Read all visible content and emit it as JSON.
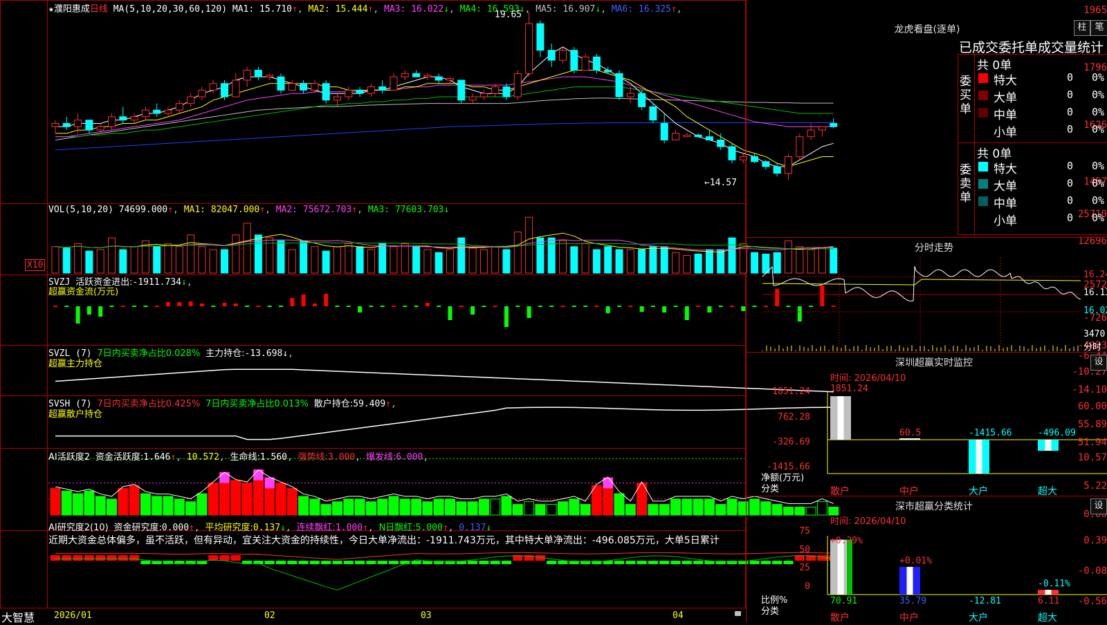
{
  "stock": {
    "star": "★",
    "name": "濮阳惠成",
    "period": "日线"
  },
  "kline": {
    "ma_def": "MA(5,10,20,30,60,120)",
    "ma": [
      {
        "label": "MA1:",
        "value": "15.710",
        "arrow": "↑",
        "color": "#ffffff"
      },
      {
        "label": "MA2:",
        "value": "15.444",
        "arrow": "↑",
        "color": "#ffff00"
      },
      {
        "label": "MA3:",
        "value": "16.022",
        "arrow": "↓",
        "color": "#ff40ff"
      },
      {
        "label": "MA4:",
        "value": "16.593",
        "arrow": "↓",
        "color": "#00ff00"
      },
      {
        "label": "MA5:",
        "value": "16.907",
        "arrow": "↓",
        "color": "#c0c0c0"
      },
      {
        "label": "MA6:",
        "value": "16.325",
        "arrow": "↑",
        "color": "#4060ff"
      }
    ],
    "y_ticks": [
      "1965",
      "1796",
      "1626",
      "1457"
    ],
    "high_label": "19.65",
    "low_label": "←14.57",
    "candles": [
      [
        16.2,
        16.4,
        16.0,
        16.3
      ],
      [
        16.3,
        16.5,
        16.1,
        16.2
      ],
      [
        16.2,
        16.6,
        16.0,
        16.4
      ],
      [
        16.4,
        16.4,
        16.0,
        16.1
      ],
      [
        16.1,
        16.3,
        16.0,
        16.2
      ],
      [
        16.2,
        16.6,
        16.1,
        16.5
      ],
      [
        16.5,
        16.8,
        16.3,
        16.4
      ],
      [
        16.4,
        16.6,
        16.3,
        16.5
      ],
      [
        16.5,
        16.8,
        16.4,
        16.7
      ],
      [
        16.7,
        16.9,
        16.5,
        16.6
      ],
      [
        16.6,
        16.8,
        16.5,
        16.7
      ],
      [
        16.7,
        17.0,
        16.6,
        16.9
      ],
      [
        16.9,
        17.2,
        16.8,
        17.1
      ],
      [
        17.1,
        17.4,
        17.0,
        17.3
      ],
      [
        17.3,
        17.6,
        17.2,
        17.5
      ],
      [
        17.5,
        17.6,
        17.0,
        17.1
      ],
      [
        17.1,
        17.8,
        17.1,
        17.6
      ],
      [
        17.6,
        18.0,
        17.4,
        17.9
      ],
      [
        17.9,
        18.0,
        17.6,
        17.7
      ],
      [
        17.7,
        17.8,
        17.6,
        17.75
      ],
      [
        17.7,
        17.8,
        17.2,
        17.3
      ],
      [
        17.3,
        17.6,
        17.3,
        17.5
      ],
      [
        17.5,
        17.6,
        17.2,
        17.3
      ],
      [
        17.3,
        17.6,
        17.2,
        17.5
      ],
      [
        17.5,
        17.6,
        16.9,
        17.0
      ],
      [
        17.0,
        17.2,
        16.8,
        17.1
      ],
      [
        17.1,
        17.4,
        17.0,
        17.3
      ],
      [
        17.3,
        17.4,
        17.1,
        17.2
      ],
      [
        17.2,
        17.5,
        17.1,
        17.4
      ],
      [
        17.4,
        17.6,
        17.2,
        17.3
      ],
      [
        17.3,
        17.8,
        17.3,
        17.7
      ],
      [
        17.7,
        17.9,
        17.6,
        17.8
      ],
      [
        17.8,
        17.9,
        17.7,
        17.7
      ],
      [
        17.7,
        17.8,
        17.6,
        17.75
      ],
      [
        17.7,
        17.8,
        17.5,
        17.6
      ],
      [
        17.6,
        17.7,
        17.5,
        17.65
      ],
      [
        17.6,
        17.6,
        16.9,
        17.0
      ],
      [
        17.0,
        17.2,
        16.9,
        17.1
      ],
      [
        17.1,
        17.3,
        17.0,
        17.2
      ],
      [
        17.2,
        17.5,
        17.1,
        17.4
      ],
      [
        17.4,
        17.5,
        17.0,
        17.1
      ],
      [
        17.1,
        17.9,
        17.0,
        17.8
      ],
      [
        17.8,
        19.65,
        17.7,
        19.3
      ],
      [
        19.3,
        19.4,
        18.3,
        18.5
      ],
      [
        18.5,
        18.7,
        18.0,
        18.2
      ],
      [
        18.2,
        18.6,
        18.1,
        18.5
      ],
      [
        18.5,
        18.6,
        17.8,
        17.9
      ],
      [
        17.9,
        18.4,
        17.9,
        18.3
      ],
      [
        18.3,
        18.4,
        17.8,
        17.9
      ],
      [
        17.9,
        18.0,
        17.8,
        17.85
      ],
      [
        17.8,
        17.9,
        17.0,
        17.1
      ],
      [
        17.1,
        17.4,
        16.9,
        17.2
      ],
      [
        17.2,
        17.3,
        16.7,
        16.8
      ],
      [
        16.8,
        16.9,
        16.3,
        16.4
      ],
      [
        16.3,
        16.6,
        15.7,
        15.8
      ],
      [
        15.8,
        16.1,
        15.8,
        16.0
      ],
      [
        15.9,
        16.0,
        15.9,
        15.95
      ],
      [
        15.95,
        16.0,
        15.9,
        15.9
      ],
      [
        15.9,
        16.1,
        15.8,
        15.8
      ],
      [
        15.8,
        16.0,
        15.5,
        15.6
      ],
      [
        15.6,
        15.7,
        15.1,
        15.2
      ],
      [
        15.2,
        15.4,
        15.1,
        15.3
      ],
      [
        15.3,
        15.4,
        15.1,
        15.15
      ],
      [
        15.15,
        15.2,
        14.9,
        15.0
      ],
      [
        15.0,
        15.1,
        14.7,
        14.8
      ],
      [
        14.8,
        15.4,
        14.6,
        15.3
      ],
      [
        15.3,
        16.0,
        15.2,
        15.9
      ],
      [
        15.9,
        16.3,
        15.8,
        16.1
      ],
      [
        16.1,
        16.2,
        15.9,
        16.2
      ],
      [
        16.3,
        16.45,
        16.15,
        16.2
      ]
    ],
    "ma_lines": {
      "ma1": [
        16.2,
        16.2,
        16.3,
        16.3,
        16.3,
        16.4,
        16.4,
        16.5,
        16.6,
        16.6,
        16.7,
        16.8,
        17.0,
        17.2,
        17.3,
        17.4,
        17.6,
        17.7,
        17.7,
        17.7,
        17.6,
        17.5,
        17.4,
        17.3,
        17.2,
        17.2,
        17.2,
        17.2,
        17.3,
        17.3,
        17.4,
        17.5,
        17.6,
        17.7,
        17.7,
        17.6,
        17.4,
        17.3,
        17.2,
        17.2,
        17.2,
        17.4,
        17.8,
        18.1,
        18.4,
        18.6,
        18.4,
        18.2,
        18.1,
        17.9,
        17.7,
        17.5,
        17.2,
        16.9,
        16.6,
        16.3,
        16.1,
        15.9,
        15.8,
        15.7,
        15.5,
        15.4,
        15.3,
        15.1,
        15.0,
        15.0,
        15.2,
        15.4,
        15.6,
        15.7
      ],
      "ma2": [
        16.0,
        16.0,
        16.1,
        16.1,
        16.2,
        16.2,
        16.3,
        16.3,
        16.4,
        16.4,
        16.5,
        16.6,
        16.7,
        16.8,
        17.0,
        17.1,
        17.2,
        17.3,
        17.4,
        17.5,
        17.5,
        17.5,
        17.5,
        17.5,
        17.4,
        17.4,
        17.3,
        17.3,
        17.3,
        17.3,
        17.3,
        17.4,
        17.4,
        17.5,
        17.5,
        17.5,
        17.5,
        17.4,
        17.4,
        17.3,
        17.3,
        17.4,
        17.5,
        17.6,
        17.7,
        17.8,
        17.9,
        17.9,
        17.9,
        17.8,
        17.7,
        17.6,
        17.4,
        17.2,
        17.0,
        16.8,
        16.5,
        16.3,
        16.1,
        15.9,
        15.7,
        15.5,
        15.4,
        15.3,
        15.1,
        15.0,
        15.1,
        15.2,
        15.3,
        15.3
      ],
      "ma3": [
        15.9,
        15.9,
        15.95,
        16.0,
        16.05,
        16.1,
        16.15,
        16.2,
        16.25,
        16.3,
        16.35,
        16.4,
        16.5,
        16.6,
        16.7,
        16.8,
        16.9,
        17.0,
        17.05,
        17.1,
        17.15,
        17.2,
        17.2,
        17.25,
        17.25,
        17.25,
        17.25,
        17.25,
        17.3,
        17.3,
        17.3,
        17.35,
        17.4,
        17.4,
        17.45,
        17.45,
        17.45,
        17.45,
        17.45,
        17.45,
        17.45,
        17.5,
        17.55,
        17.6,
        17.65,
        17.7,
        17.7,
        17.7,
        17.65,
        17.6,
        17.55,
        17.45,
        17.35,
        17.25,
        17.15,
        17.05,
        16.95,
        16.85,
        16.75,
        16.65,
        16.55,
        16.45,
        16.35,
        16.3,
        16.25,
        16.2,
        16.2,
        16.2,
        16.2,
        16.2
      ],
      "ma4": [
        15.9,
        15.9,
        15.9,
        15.95,
        15.95,
        16.0,
        16.0,
        16.05,
        16.1,
        16.1,
        16.15,
        16.2,
        16.25,
        16.3,
        16.35,
        16.4,
        16.45,
        16.5,
        16.55,
        16.6,
        16.65,
        16.7,
        16.75,
        16.8,
        16.85,
        16.85,
        16.9,
        16.9,
        16.95,
        16.95,
        17.0,
        17.0,
        17.05,
        17.05,
        17.1,
        17.1,
        17.1,
        17.1,
        17.1,
        17.1,
        17.1,
        17.15,
        17.2,
        17.25,
        17.3,
        17.35,
        17.4,
        17.4,
        17.4,
        17.4,
        17.4,
        17.35,
        17.3,
        17.25,
        17.2,
        17.15,
        17.1,
        17.05,
        17.0,
        16.95,
        16.9,
        16.85,
        16.8,
        16.75,
        16.7,
        16.65,
        16.6,
        16.6,
        16.6,
        16.6
      ],
      "ma5": [
        15.8,
        15.85,
        15.9,
        15.95,
        16.0,
        16.05,
        16.1,
        16.15,
        16.2,
        16.25,
        16.3,
        16.35,
        16.4,
        16.45,
        16.5,
        16.55,
        16.6,
        16.65,
        16.7,
        16.72,
        16.74,
        16.76,
        16.78,
        16.8,
        16.8,
        16.8,
        16.82,
        16.84,
        16.85,
        16.86,
        16.87,
        16.88,
        16.89,
        16.9,
        16.9,
        16.9,
        16.9,
        16.9,
        16.9,
        16.9,
        16.9,
        16.92,
        16.95,
        16.98,
        17.0,
        17.02,
        17.04,
        17.05,
        17.06,
        17.06,
        17.05,
        17.04,
        17.03,
        17.02,
        17.01,
        17.0,
        16.99,
        16.98,
        16.97,
        16.96,
        16.95,
        16.94,
        16.93,
        16.93,
        16.92,
        16.92,
        16.91,
        16.91,
        16.91,
        16.91
      ],
      "ma6": [
        15.5,
        15.52,
        15.54,
        15.56,
        15.58,
        15.6,
        15.62,
        15.64,
        15.66,
        15.68,
        15.7,
        15.72,
        15.74,
        15.76,
        15.78,
        15.8,
        15.82,
        15.84,
        15.86,
        15.88,
        15.9,
        15.92,
        15.94,
        15.96,
        15.98,
        16.0,
        16.02,
        16.04,
        16.06,
        16.08,
        16.1,
        16.12,
        16.14,
        16.16,
        16.18,
        16.2,
        16.21,
        16.22,
        16.23,
        16.24,
        16.25,
        16.26,
        16.27,
        16.28,
        16.29,
        16.3,
        16.3,
        16.31,
        16.31,
        16.32,
        16.32,
        16.32,
        16.32,
        16.32,
        16.32,
        16.32,
        16.32,
        16.32,
        16.32,
        16.32,
        16.32,
        16.32,
        16.32,
        16.32,
        16.32,
        16.32,
        16.32,
        16.32,
        16.32,
        16.32
      ]
    }
  },
  "vol": {
    "title": "VOL(5,10,20)",
    "val": "74699.000",
    "val_arrow": "↑",
    "ma1": "MA1: 82047.000",
    "ma1_arrow": "↑",
    "ma2": "MA2: 75672.703",
    "ma2_arrow": "↑",
    "ma3": "MA3: 77603.703",
    "ma3_arrow": "↓",
    "y_ticks": [
      "25710",
      "12696"
    ],
    "unit": "X10",
    "bars": [
      9000,
      8500,
      10000,
      7500,
      8000,
      12000,
      8000,
      9000,
      11000,
      9000,
      10000,
      9000,
      13000,
      9000,
      8000,
      8000,
      13000,
      17000,
      13000,
      12000,
      11000,
      8000,
      11000,
      9000,
      7500,
      9000,
      10000,
      9000,
      8000,
      10000,
      9000,
      10000,
      9000,
      8000,
      7000,
      8000,
      12000,
      8500,
      8000,
      9000,
      8000,
      14000,
      19000,
      12000,
      12000,
      11000,
      9000,
      10000,
      8000,
      9000,
      8000,
      8000,
      8000,
      9000,
      9000,
      7000,
      6000,
      6500,
      8000,
      8000,
      12000,
      10000,
      7000,
      6500,
      7000,
      11000,
      9000,
      8000,
      8500,
      8500
    ]
  },
  "svzj": {
    "title": "SVZJ",
    "label": "活跃资金进出:",
    "val": "-1911.734",
    "arrow": "↓",
    "sub": "超赢资金流(万元)",
    "y_ticks": [
      "2572",
      "-726",
      "-4023"
    ],
    "bars": [
      0,
      0,
      -2500,
      -1200,
      -1500,
      0,
      0,
      0,
      0,
      0,
      600,
      600,
      700,
      400,
      0,
      500,
      400,
      0,
      0,
      0,
      0,
      1200,
      1700,
      400,
      1800,
      0,
      0,
      -900,
      0,
      0,
      0,
      0,
      0,
      500,
      0,
      -2000,
      0,
      -1200,
      0,
      0,
      -3000,
      0,
      -1700,
      0,
      0,
      0,
      0,
      0,
      0,
      -1000,
      0,
      0,
      -800,
      0,
      -900,
      0,
      -2000,
      0,
      -900,
      0,
      0,
      -700,
      0,
      0,
      2500,
      0,
      -2200,
      0,
      3000,
      0,
      0,
      0,
      0,
      0,
      -2000
    ]
  },
  "svzl": {
    "title": "SVZL (7)",
    "t1": "7日内买卖净占比0.028%",
    "t2": "主力持仓:",
    "val": "-13.698",
    "arrow": "↓",
    "sub": "超赢主力持仓",
    "y_ticks": [
      "-6.44",
      "-10.27",
      "-14.10"
    ]
  },
  "svsh": {
    "title": "SVSH (7)",
    "t1": "7日内买卖净占比0.425%",
    "t2": "7日内买卖净占比0.013%",
    "t3": "散户持仓:",
    "val": "59.409",
    "arrow": "↑",
    "sub": "超赢散户持仓",
    "y_ticks": [
      "60.00",
      "55.89",
      "51.94"
    ]
  },
  "ai1": {
    "title": "AI活跃度2",
    "l1": "资金活跃度:",
    "v1": "1.646",
    "a1": "↑",
    "v2": "10.572",
    "l3": "生命线:",
    "v3": "1.560",
    "l4": "强势线:",
    "v4": "3.000",
    "l5": "爆发线:",
    "v5": "6.000",
    "y_ticks": [
      "10.57",
      "5.22",
      "0.00"
    ],
    "bars": [
      5,
      4.5,
      4,
      4.5,
      3.5,
      3,
      5,
      5.5,
      4,
      3.5,
      3.5,
      3,
      2.5,
      4,
      6,
      8,
      6.5,
      6,
      8.5,
      7,
      6,
      5,
      3.5,
      3,
      2,
      2.5,
      3,
      3,
      2.5,
      3,
      3.5,
      3,
      3,
      2.5,
      3,
      3,
      2.5,
      2.5,
      3,
      3,
      3.5,
      2,
      2.5,
      2,
      2,
      2.5,
      3,
      2,
      5.5,
      7,
      4,
      2,
      6,
      2,
      2,
      3,
      3,
      3,
      3,
      2,
      3,
      2.5,
      3,
      2.5,
      2,
      1.5,
      1.5,
      1.5,
      2.5,
      1.5,
      1.5,
      3
    ]
  },
  "ai2": {
    "title": "AI研究度2(10)",
    "l1": "资金研究度:",
    "v1": "0.000",
    "a1": "↑",
    "l2": "平均研究度:",
    "v2": "0.137",
    "a2": "↓",
    "l3": "连续飘红:",
    "v3": "1.000",
    "a3": "↑",
    "l4": "N日飘红:",
    "v4": "5.000",
    "a4": "↑",
    "v5": "0.137",
    "a5": "↓",
    "text": "近期大资金总体偏多，虽不活跃，但有异动，宜关注大资金的持续性，今日大单净流出：-1911.743万元，其中特大单净流出：-496.085万元，大单5日累计",
    "y_ticks": [
      "0.39",
      "-0.08",
      "-0.56"
    ]
  },
  "xaxis": {
    "labels": [
      "2026/01",
      "02",
      "03",
      "04"
    ],
    "brand": "大智慧"
  },
  "dragon": {
    "title": "龙虎看盘(逐单)",
    "btn1": "柱",
    "btn2": "笔",
    "header": "已成交委托单成交量统计",
    "buy": {
      "side": "委买单",
      "total": "共 0单",
      "rows": [
        {
          "name": "特大",
          "n": "0",
          "p": "0%",
          "color": "#ff0000"
        },
        {
          "name": "大单",
          "n": "0",
          "p": "0%",
          "color": "#800000"
        },
        {
          "name": "中单",
          "n": "0",
          "p": "0%",
          "color": "#600000"
        },
        {
          "name": "小单",
          "n": "0",
          "p": "0%",
          "color": ""
        }
      ]
    },
    "sell": {
      "side": "委卖单",
      "total": "共 0单",
      "rows": [
        {
          "name": "特大",
          "n": "0",
          "p": "0%",
          "color": "#00ffff"
        },
        {
          "name": "大单",
          "n": "0",
          "p": "0%",
          "color": "#008080"
        },
        {
          "name": "中单",
          "n": "0",
          "p": "0%",
          "color": "#006060"
        },
        {
          "name": "小单",
          "n": "0",
          "p": "0%",
          "color": ""
        }
      ]
    }
  },
  "intraday": {
    "title": "分时走势",
    "y_ticks": [
      "16.24",
      "16.13",
      "16.02"
    ],
    "vol_tick": "3470",
    "footer": "分时"
  },
  "sz_monitor": {
    "title": "深圳超赢实时监控",
    "btn": "设",
    "time": "时间: 2026/04/10",
    "y_ticks": [
      "1851.24",
      "762.28",
      "-326.69",
      "-1415.66"
    ],
    "yl": "净额(万元)",
    "xl": "分类",
    "cats": [
      "散户",
      "中户",
      "大户",
      "超大"
    ],
    "vals": [
      "1851.24",
      "60.5",
      "-1415.66",
      "-496.09"
    ]
  },
  "sz_stats": {
    "title": "深市超赢分类统计",
    "btn": "设",
    "time": "时间: 2026/04/10",
    "y_ticks": [
      "75",
      "50",
      "25",
      "0"
    ],
    "yl": "比例%",
    "xl": "分类",
    "cats": [
      "散户",
      "中户",
      "大户",
      "超大"
    ],
    "tops": [
      "+0.29%",
      "+0.01%",
      "",
      "-0.11%"
    ],
    "vals": [
      "70.91",
      "35.79",
      "-12.81",
      "6.11"
    ]
  }
}
